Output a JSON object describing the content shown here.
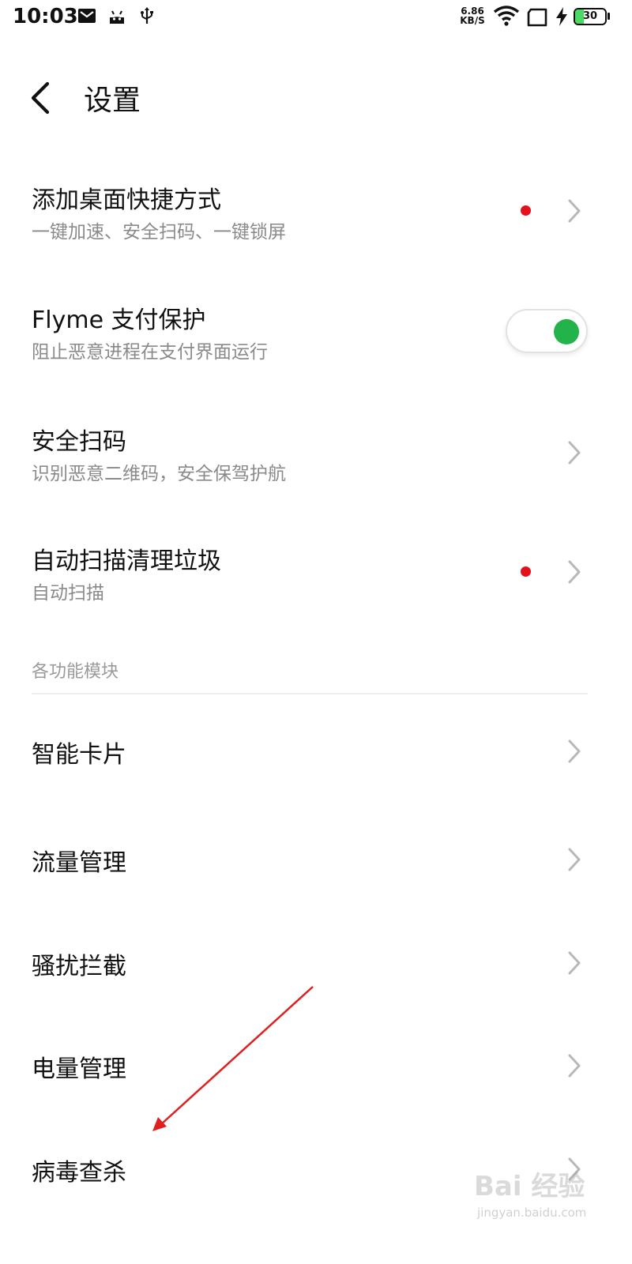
{
  "status_bar": {
    "time": "10:03",
    "net_speed_value": "6.86",
    "net_speed_unit": "KB/S",
    "battery": "30",
    "battery_level": 0.3,
    "icons": [
      "mail-icon",
      "android-icon",
      "usb-icon",
      "wifi-icon",
      "sim-icon",
      "charging-icon",
      "battery-icon"
    ]
  },
  "header": {
    "title": "设置",
    "back_icon": "back-arrow-icon"
  },
  "items_top": [
    {
      "title": "添加桌面快捷方式",
      "subtitle": "一键加速、安全扫码、一键锁屏",
      "badge": true,
      "control": "chevron"
    },
    {
      "title": "Flyme 支付保护",
      "subtitle": "阻止恶意进程在支付界面运行",
      "control": "toggle",
      "toggle_on": true
    },
    {
      "title": "安全扫码",
      "subtitle": "识别恶意二维码，安全保驾护航",
      "control": "chevron"
    },
    {
      "title": "自动扫描清理垃圾",
      "subtitle": "自动扫描",
      "badge": true,
      "control": "chevron"
    }
  ],
  "section": {
    "label": "各功能模块"
  },
  "modules": [
    {
      "title": "智能卡片"
    },
    {
      "title": "流量管理"
    },
    {
      "title": "骚扰拦截"
    },
    {
      "title": "电量管理"
    },
    {
      "title": "病毒查杀"
    }
  ],
  "colors": {
    "accent_green": "#22b34a",
    "badge_red": "#e4111b",
    "annotation_red": "#e02020",
    "subtitle_gray": "#8a8a8a"
  },
  "watermark": {
    "brand": "Bai 经验",
    "url": "jingyan.baidu.com"
  }
}
